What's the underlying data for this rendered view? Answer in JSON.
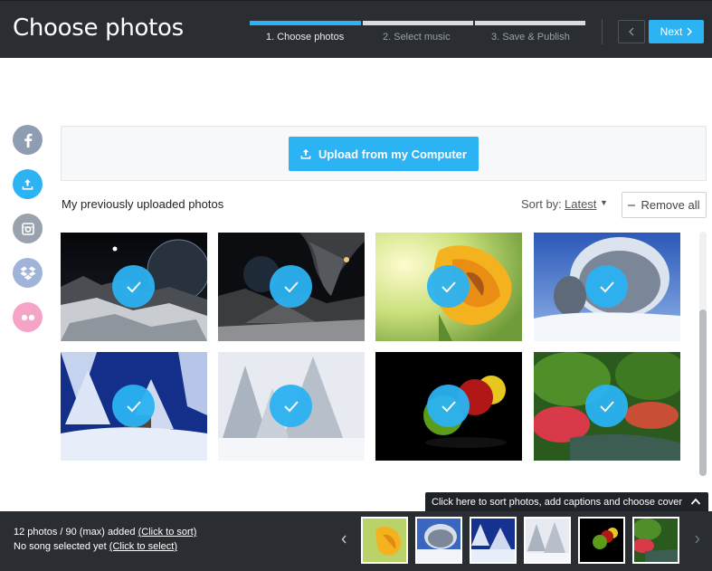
{
  "header": {
    "title": "Choose photos",
    "steps": [
      {
        "label": "1. Choose photos",
        "active": true
      },
      {
        "label": "2. Select music",
        "active": false
      },
      {
        "label": "3. Save & Publish",
        "active": false
      }
    ],
    "prev_icon": "chevron-left-icon",
    "next_label": "Next",
    "next_icon": "chevron-right-icon",
    "accent": "#2bb3f3",
    "bar_bg": "#2a2e33"
  },
  "sources": [
    {
      "name": "facebook",
      "icon": "facebook-icon",
      "color": "#8f9db3"
    },
    {
      "name": "upload",
      "icon": "upload-icon",
      "color": "#2bb3f3"
    },
    {
      "name": "instagram",
      "icon": "instagram-icon",
      "color": "#9aa3ad"
    },
    {
      "name": "dropbox",
      "icon": "dropbox-icon",
      "color": "#9fb4d8"
    },
    {
      "name": "flickr",
      "icon": "flickr-icon",
      "color": "#f5a3c7"
    }
  ],
  "upload": {
    "button_label": "Upload from my Computer",
    "icon": "upload-icon"
  },
  "library": {
    "title": "My previously uploaded photos",
    "sort_label": "Sort by:",
    "sort_value": "Latest",
    "remove_all_label": "Remove all",
    "photos": [
      {
        "subject": "alien moon landscape",
        "selected": true
      },
      {
        "subject": "dark planet with smoke",
        "selected": true
      },
      {
        "subject": "yellow tulip",
        "selected": true
      },
      {
        "subject": "snowy tree blue sky",
        "selected": true
      },
      {
        "subject": "snow forest night",
        "selected": true
      },
      {
        "subject": "snowy pine trees",
        "selected": true
      },
      {
        "subject": "apples on black",
        "selected": true
      },
      {
        "subject": "garden pond",
        "selected": true
      }
    ]
  },
  "tooltip": {
    "text": "Click here to sort photos, add captions and choose cover",
    "icon": "chevron-up-icon"
  },
  "footer": {
    "count_text": "12 photos / 90 (max) added ",
    "count_link": "(Click to sort)",
    "song_text": "No song selected yet ",
    "song_link": "(Click to select)",
    "prev_icon": "chevron-left-icon",
    "next_icon": "chevron-right-icon",
    "thumbnails": [
      "tulip",
      "snowy tree",
      "snow forest",
      "snowy pines",
      "apples",
      "garden"
    ]
  }
}
